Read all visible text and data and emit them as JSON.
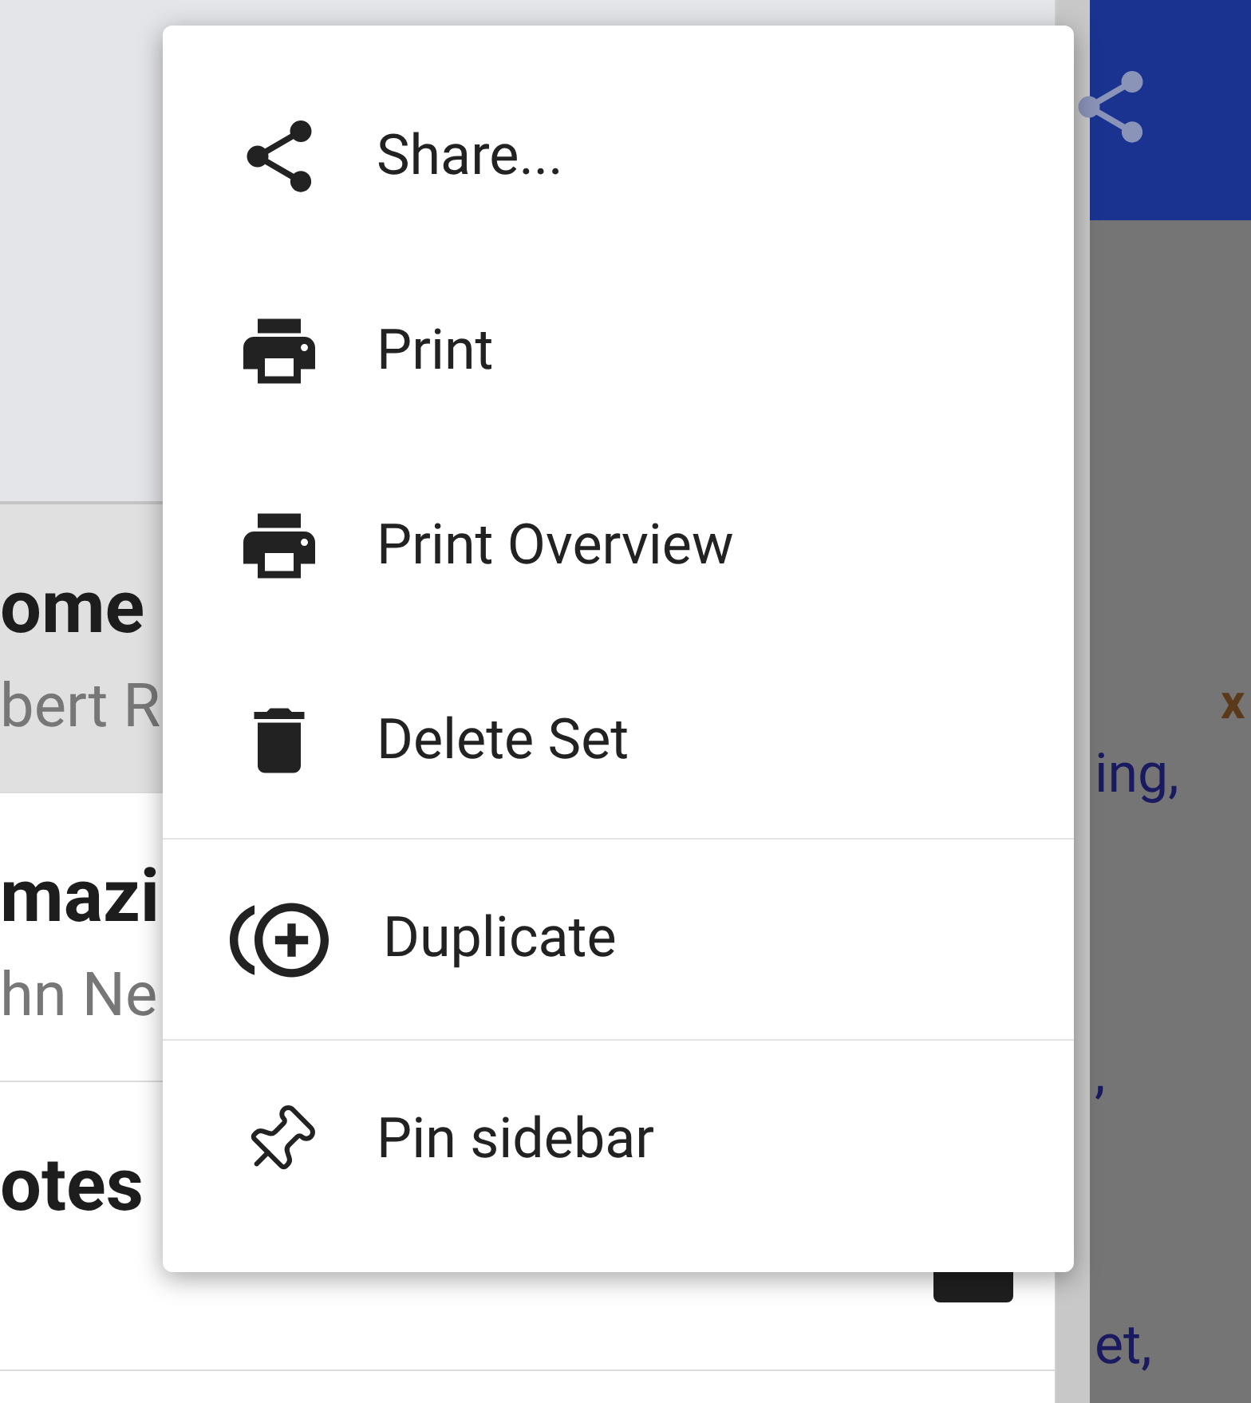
{
  "sidebar": {
    "items": [
      {
        "title": "ome",
        "subtitle": "bert R",
        "selected": true
      },
      {
        "title": "mazi",
        "subtitle": "hn Ne",
        "selected": false
      },
      {
        "title": "otes",
        "selected": false
      }
    ]
  },
  "content": {
    "marker": "x",
    "lines": [
      "ing,",
      ",",
      "et,"
    ]
  },
  "menu": {
    "groups": [
      [
        {
          "label": "Share..."
        },
        {
          "label": "Print"
        },
        {
          "label": "Print Overview"
        },
        {
          "label": "Delete Set"
        }
      ],
      [
        {
          "label": "Duplicate"
        }
      ],
      [
        {
          "label": "Pin sidebar"
        }
      ]
    ]
  }
}
